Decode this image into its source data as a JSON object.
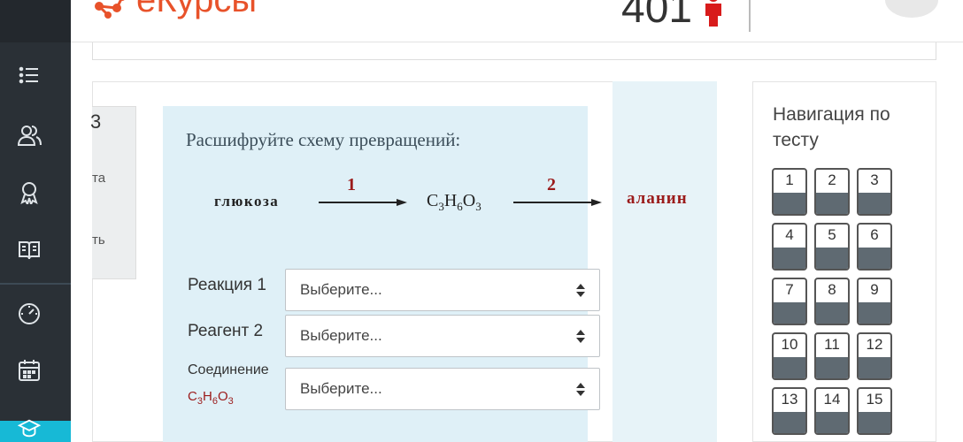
{
  "header": {
    "logo_text": "еКурсы",
    "counter": "401"
  },
  "info": {
    "line1": "3",
    "line2": "та",
    "line3": "ть"
  },
  "question": {
    "title": "Расшифруйте схему превращений:",
    "scheme": {
      "start": "глюкоза",
      "arrow1": "1",
      "middle": {
        "base1": "C",
        "sub1": "3",
        "base2": "H",
        "sub2": "6",
        "base3": "O",
        "sub3": "3"
      },
      "arrow2": "2",
      "end": "аланин"
    },
    "rows": [
      {
        "label": "Реакция 1",
        "value": "Выберите..."
      },
      {
        "label": "Реагент 2",
        "value": "Выберите..."
      },
      {
        "label": "Соединение",
        "sub_label": {
          "a": "C",
          "b": "3",
          "c": "H",
          "d": "6",
          "e": "O",
          "f": "3"
        },
        "value": "Выберите..."
      }
    ]
  },
  "navigation": {
    "title": "Навигация по тесту",
    "buttons": [
      "1",
      "2",
      "3",
      "4",
      "5",
      "6",
      "7",
      "8",
      "9",
      "10",
      "11",
      "12",
      "13",
      "14",
      "15"
    ]
  },
  "colors": {
    "sidebar": "#2a3036",
    "accent": "#17b9d6",
    "logo": "#e8522a",
    "question_bg": "#dff0f7",
    "dark_red": "#9b1b1b"
  }
}
